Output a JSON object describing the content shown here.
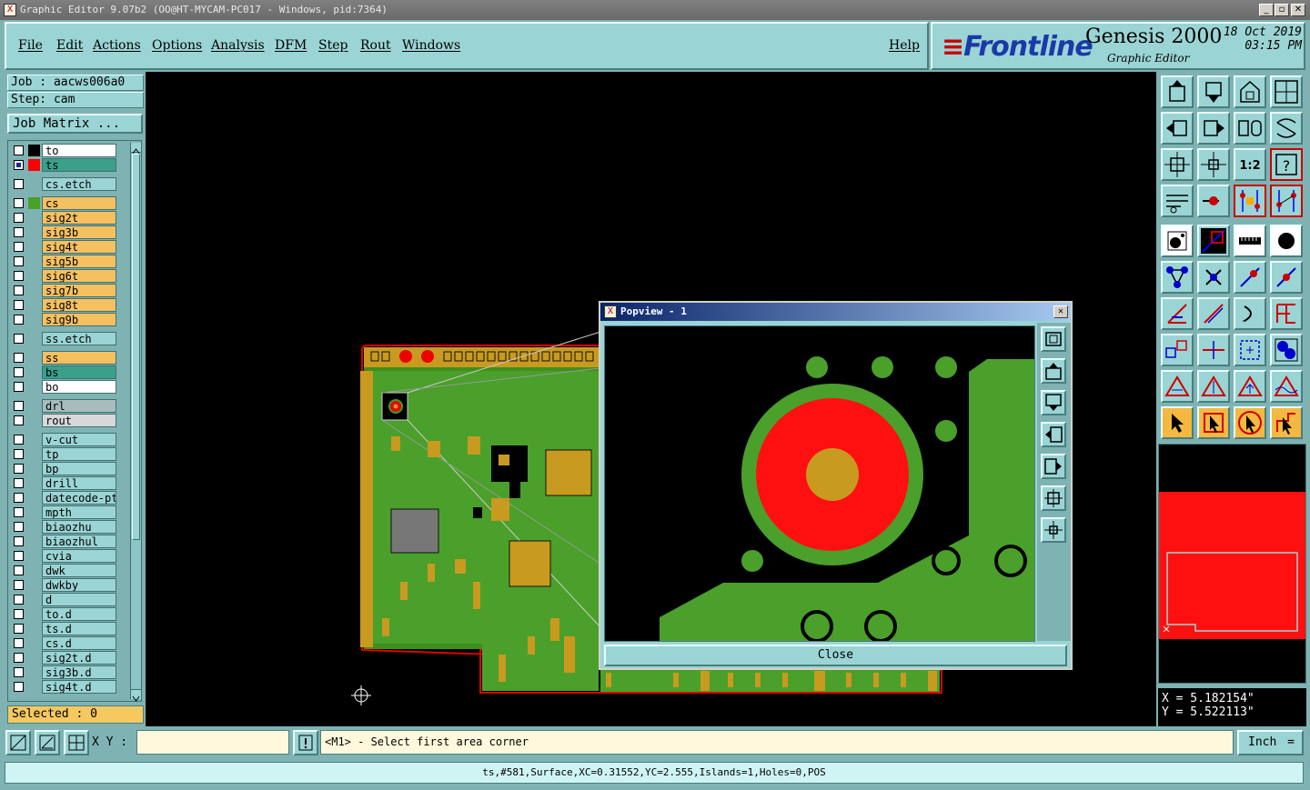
{
  "window": {
    "title": "Graphic Editor 9.07b2 (OO@HT-MYCAM-PC017 - Windows, pid:7364)",
    "minimize": "_",
    "maximize": "▫",
    "close": "✕"
  },
  "menu": {
    "items": [
      "File",
      "Edit",
      "Actions",
      "Options",
      "Analysis",
      "DFM",
      "Step",
      "Rout",
      "Windows"
    ],
    "help": "Help"
  },
  "logo": {
    "brand_prefix": "≡",
    "brand": "Frontline",
    "product": "Genesis 2000",
    "subtitle": "Graphic Editor",
    "date": "18 Oct 2019",
    "time": "03:15 PM"
  },
  "job": {
    "job_label": "Job : aacws006a0",
    "step_label": "Step: cam",
    "job_matrix": "Job Matrix ..."
  },
  "layers": [
    {
      "name": "to",
      "swatch": "#000000",
      "color": "#ffffff",
      "checked": false,
      "group": 1
    },
    {
      "name": "ts",
      "swatch": "#ff0000",
      "color": "#3aa08a",
      "checked": true,
      "group": 1
    },
    {
      "name": "cs.etch",
      "swatch": "#7fb3b3",
      "color": "#9bd4d4",
      "checked": false,
      "group": 2
    },
    {
      "name": "cs",
      "swatch": "#4aa02a",
      "color": "#f5c060",
      "checked": false,
      "group": 3
    },
    {
      "name": "sig2t",
      "swatch": "#7fb3b3",
      "color": "#f5c060",
      "checked": false,
      "group": 3
    },
    {
      "name": "sig3b",
      "swatch": "#7fb3b3",
      "color": "#f5c060",
      "checked": false,
      "group": 3
    },
    {
      "name": "sig4t",
      "swatch": "#7fb3b3",
      "color": "#f5c060",
      "checked": false,
      "group": 3
    },
    {
      "name": "sig5b",
      "swatch": "#7fb3b3",
      "color": "#f5c060",
      "checked": false,
      "group": 3
    },
    {
      "name": "sig6t",
      "swatch": "#7fb3b3",
      "color": "#f5c060",
      "checked": false,
      "group": 3
    },
    {
      "name": "sig7b",
      "swatch": "#7fb3b3",
      "color": "#f5c060",
      "checked": false,
      "group": 3
    },
    {
      "name": "sig8t",
      "swatch": "#7fb3b3",
      "color": "#f5c060",
      "checked": false,
      "group": 3
    },
    {
      "name": "sig9b",
      "swatch": "#7fb3b3",
      "color": "#f5c060",
      "checked": false,
      "group": 3
    },
    {
      "name": "ss.etch",
      "swatch": "#7fb3b3",
      "color": "#9bd4d4",
      "checked": false,
      "group": 4
    },
    {
      "name": "ss",
      "swatch": "#7fb3b3",
      "color": "#f5c060",
      "checked": false,
      "group": 5
    },
    {
      "name": "bs",
      "swatch": "#7fb3b3",
      "color": "#3aa08a",
      "checked": false,
      "group": 5
    },
    {
      "name": "bo",
      "swatch": "#7fb3b3",
      "color": "#ffffff",
      "checked": false,
      "group": 5
    },
    {
      "name": "drl",
      "swatch": "#7fb3b3",
      "color": "#a8bcbc",
      "checked": false,
      "group": 6
    },
    {
      "name": "rout",
      "swatch": "#7fb3b3",
      "color": "#d8d8d8",
      "checked": false,
      "group": 6
    },
    {
      "name": "v-cut",
      "swatch": "#7fb3b3",
      "color": "#9bd4d4",
      "checked": false,
      "group": 7
    },
    {
      "name": "tp",
      "swatch": "#7fb3b3",
      "color": "#9bd4d4",
      "checked": false,
      "group": 7
    },
    {
      "name": "bp",
      "swatch": "#7fb3b3",
      "color": "#9bd4d4",
      "checked": false,
      "group": 7
    },
    {
      "name": "drill",
      "swatch": "#7fb3b3",
      "color": "#9bd4d4",
      "checked": false,
      "group": 7
    },
    {
      "name": "datecode-pte",
      "swatch": "#7fb3b3",
      "color": "#9bd4d4",
      "checked": false,
      "group": 7
    },
    {
      "name": "mpth",
      "swatch": "#7fb3b3",
      "color": "#9bd4d4",
      "checked": false,
      "group": 7
    },
    {
      "name": "biaozhu",
      "swatch": "#7fb3b3",
      "color": "#9bd4d4",
      "checked": false,
      "group": 7
    },
    {
      "name": "biaozhul",
      "swatch": "#7fb3b3",
      "color": "#9bd4d4",
      "checked": false,
      "group": 7
    },
    {
      "name": "cvia",
      "swatch": "#7fb3b3",
      "color": "#9bd4d4",
      "checked": false,
      "group": 7
    },
    {
      "name": "dwk",
      "swatch": "#7fb3b3",
      "color": "#9bd4d4",
      "checked": false,
      "group": 7
    },
    {
      "name": "dwkby",
      "swatch": "#7fb3b3",
      "color": "#9bd4d4",
      "checked": false,
      "group": 7
    },
    {
      "name": "d",
      "swatch": "#7fb3b3",
      "color": "#9bd4d4",
      "checked": false,
      "group": 7
    },
    {
      "name": "to.d",
      "swatch": "#7fb3b3",
      "color": "#9bd4d4",
      "checked": false,
      "group": 7
    },
    {
      "name": "ts.d",
      "swatch": "#7fb3b3",
      "color": "#9bd4d4",
      "checked": false,
      "group": 7
    },
    {
      "name": "cs.d",
      "swatch": "#7fb3b3",
      "color": "#9bd4d4",
      "checked": false,
      "group": 7
    },
    {
      "name": "sig2t.d",
      "swatch": "#7fb3b3",
      "color": "#9bd4d4",
      "checked": false,
      "group": 7
    },
    {
      "name": "sig3b.d",
      "swatch": "#7fb3b3",
      "color": "#9bd4d4",
      "checked": false,
      "group": 7
    },
    {
      "name": "sig4t.d",
      "swatch": "#7fb3b3",
      "color": "#9bd4d4",
      "checked": false,
      "group": 7
    }
  ],
  "selected": "Selected : 0",
  "popview": {
    "title": "Popview - 1",
    "close": "Close"
  },
  "toolbar_icons": [
    "zoom-home-icon",
    "zoom-fit-icon",
    "zoom-home-step-icon",
    "zoom-window-icon",
    "pan-left-icon",
    "pan-right-icon",
    "zoom-reset-icon",
    "zoom-flip-icon",
    "zoom-in-icon",
    "zoom-out-icon",
    "scale-1-2-icon",
    "help-query-icon",
    "snap-grid-icon",
    "snap-center-icon",
    "measure-point-icon",
    "measure-edge-icon",
    "pad-select-icon",
    "polarity-icon",
    "ruler-icon",
    "filled-circle-icon",
    "connect-points-icon",
    "cross-snap-icon",
    "snap-skeleton-icon",
    "snap-midpoint-icon",
    "angle-icon",
    "line-draw-icon",
    "arc-icon",
    "feature-icon",
    "move-feature-icon",
    "split-icon",
    "scale-box-icon",
    "group-icon",
    "triangle-left-icon",
    "triangle-right-icon",
    "triangle-arrow-icon",
    "triangle-wave-icon",
    "select-cursor-icon",
    "select-box-icon",
    "select-circle-icon",
    "select-route-icon"
  ],
  "coords": {
    "x": "X = 5.182154\"",
    "y": "Y = 5.522113\""
  },
  "bottom": {
    "xy_label": "X Y :",
    "xy_value": "",
    "prompt": "<M1> - Select first area corner",
    "units": "Inch",
    "units_arrow": "="
  },
  "status": "ts,#581,Surface,XC=0.31552,YC=2.555,Islands=1,Holes=0,POS"
}
